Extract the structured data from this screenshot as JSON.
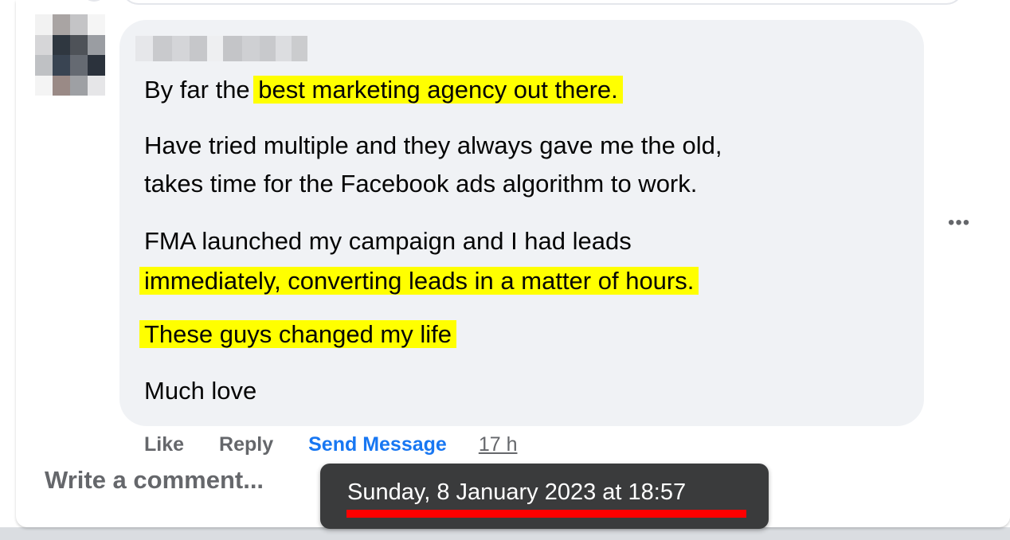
{
  "comment": {
    "paragraphs": [
      {
        "pre": "By far the ",
        "highlight": "best marketing agency out there.",
        "post": ""
      },
      {
        "lines": [
          "Have tried multiple and they always gave me the old,",
          "takes time for the Facebook ads algorithm to work."
        ]
      },
      {
        "line1": "FMA launched my campaign and I had leads",
        "line2_highlight": "immediately, converting leads in a matter of hours."
      },
      {
        "highlight": "These guys changed my life"
      },
      {
        "text": "Much love"
      }
    ],
    "more_icon": "more-horizontal-icon"
  },
  "actions": {
    "like": "Like",
    "reply": "Reply",
    "send_message": "Send Message",
    "timestamp": "17 h"
  },
  "composer": {
    "placeholder": "Write a comment..."
  },
  "tooltip": {
    "text": "Sunday, 8 January 2023 at 18:57"
  },
  "colors": {
    "highlight": "#ffff00",
    "link": "#1877f2",
    "muted": "#65676b",
    "bubble": "#f0f2f5",
    "tooltip_bg": "#3a3b3c",
    "underline": "#ff0000"
  }
}
